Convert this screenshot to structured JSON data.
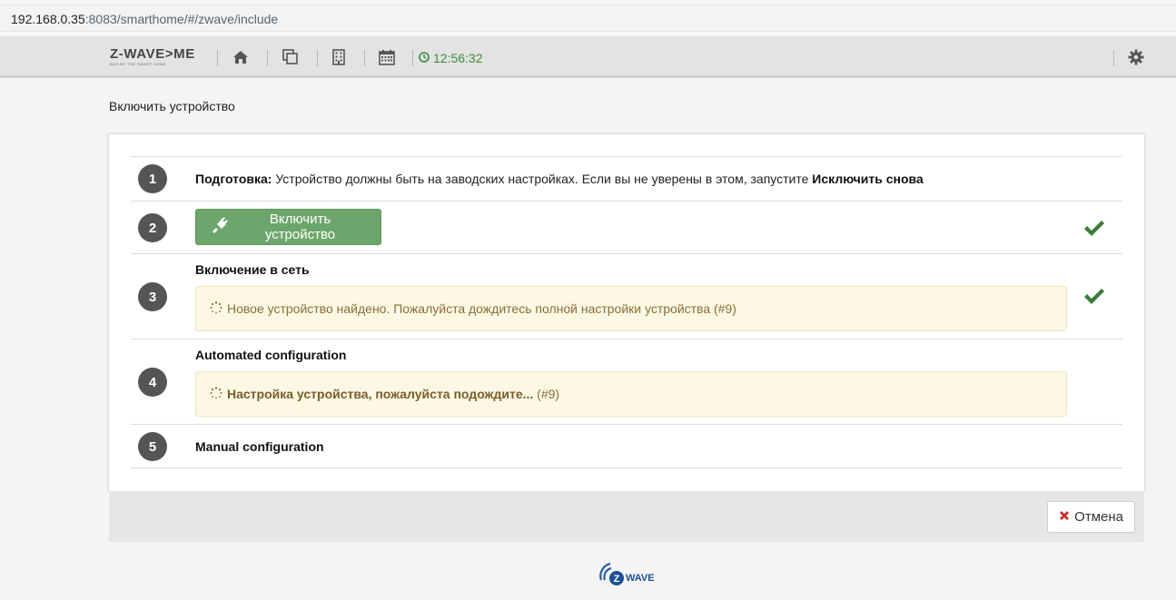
{
  "browser": {
    "url_host": "192.168.0.35",
    "url_rest": ":8083/smarthome/#/zwave/include"
  },
  "navbar": {
    "logo_text": "Z-WAVE>ME",
    "logo_sub": "BUILDS THE SMART HOME",
    "clock": "12:56:32",
    "icons": [
      "home-icon",
      "copy-icon",
      "building-icon",
      "calendar-icon",
      "gear-icon"
    ]
  },
  "page": {
    "title": "Включить устройство"
  },
  "steps": [
    {
      "number": "1",
      "label_bold": "Подготовка:",
      "text": " Устройство должны быть на заводских настройках. Если вы не уверены в этом, запустите ",
      "link_bold": "Исключить снова"
    },
    {
      "number": "2",
      "button_label": "Включить устройство",
      "done": true
    },
    {
      "number": "3",
      "heading": "Включение в сеть",
      "alert": "Новое устройство найдено. Пожалуйста дождитесь полной настройки устройства (#9)",
      "done": true
    },
    {
      "number": "4",
      "heading": "Automated configuration",
      "alert_bold": "Настройка устройства, пожалуйста подождите...",
      "alert_suffix": " (#9)"
    },
    {
      "number": "5",
      "heading": "Manual configuration"
    }
  ],
  "footer": {
    "cancel_label": "Отмена"
  },
  "brand": {
    "zwave_logo": "WAVE"
  },
  "colors": {
    "success": "#3a7d3a",
    "button_green": "#6da66d",
    "alert_bg": "#fcf8e3",
    "alert_text": "#8a6d3b",
    "cancel_red": "#c9302c",
    "step_circle": "#555555"
  }
}
